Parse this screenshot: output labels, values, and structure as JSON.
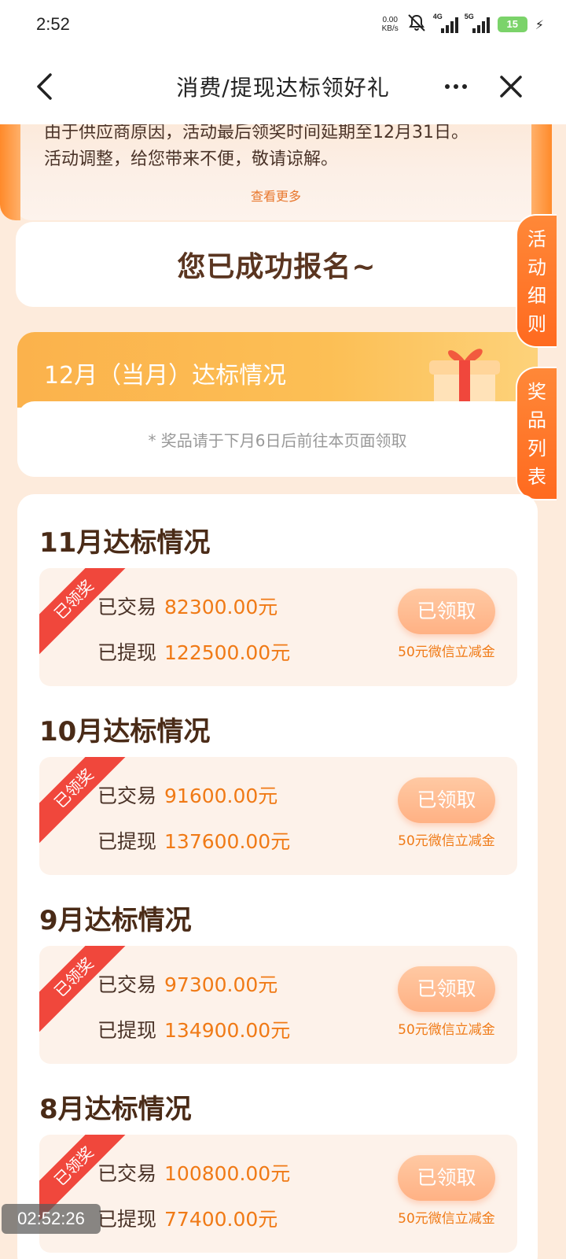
{
  "status_bar": {
    "time": "2:52",
    "net_speed_value": "0.00",
    "net_speed_unit": "KB/s",
    "signal1_label": "4G",
    "signal2_label": "5G",
    "battery": "15"
  },
  "nav": {
    "title": "消费/提现达标领好礼"
  },
  "notice": {
    "line1": "由于供应商原因，活动最后领奖时间延期至12月31日。",
    "line2": "活动调整，给您带来不便，敬请谅解。",
    "see_more": "查看更多"
  },
  "registered": {
    "text": "您已成功报名~"
  },
  "side_tabs": {
    "rules": [
      "活",
      "动",
      "细",
      "则"
    ],
    "prizes": [
      "奖",
      "品",
      "列",
      "表"
    ]
  },
  "current_month": {
    "title": "12月（当月）达标情况",
    "note": "* 奖品请于下月6日后前往本页面领取"
  },
  "history": [
    {
      "title": "11月达标情况",
      "ribbon": "已领奖",
      "trade_label": "已交易",
      "trade_value": "82300.00元",
      "withdraw_label": "已提现",
      "withdraw_value": "122500.00元",
      "button": "已领取",
      "prize": "50元微信立减金"
    },
    {
      "title": "10月达标情况",
      "ribbon": "已领奖",
      "trade_label": "已交易",
      "trade_value": "91600.00元",
      "withdraw_label": "已提现",
      "withdraw_value": "137600.00元",
      "button": "已领取",
      "prize": "50元微信立减金"
    },
    {
      "title": "9月达标情况",
      "ribbon": "已领奖",
      "trade_label": "已交易",
      "trade_value": "97300.00元",
      "withdraw_label": "已提现",
      "withdraw_value": "134900.00元",
      "button": "已领取",
      "prize": "50元微信立减金"
    },
    {
      "title": "8月达标情况",
      "ribbon": "已领奖",
      "trade_label": "已交易",
      "trade_value": "100800.00元",
      "withdraw_label": "已提现",
      "withdraw_value": "77400.00元",
      "button": "已领取",
      "prize": "50元微信立减金"
    }
  ],
  "recording_time": "02:52:26"
}
